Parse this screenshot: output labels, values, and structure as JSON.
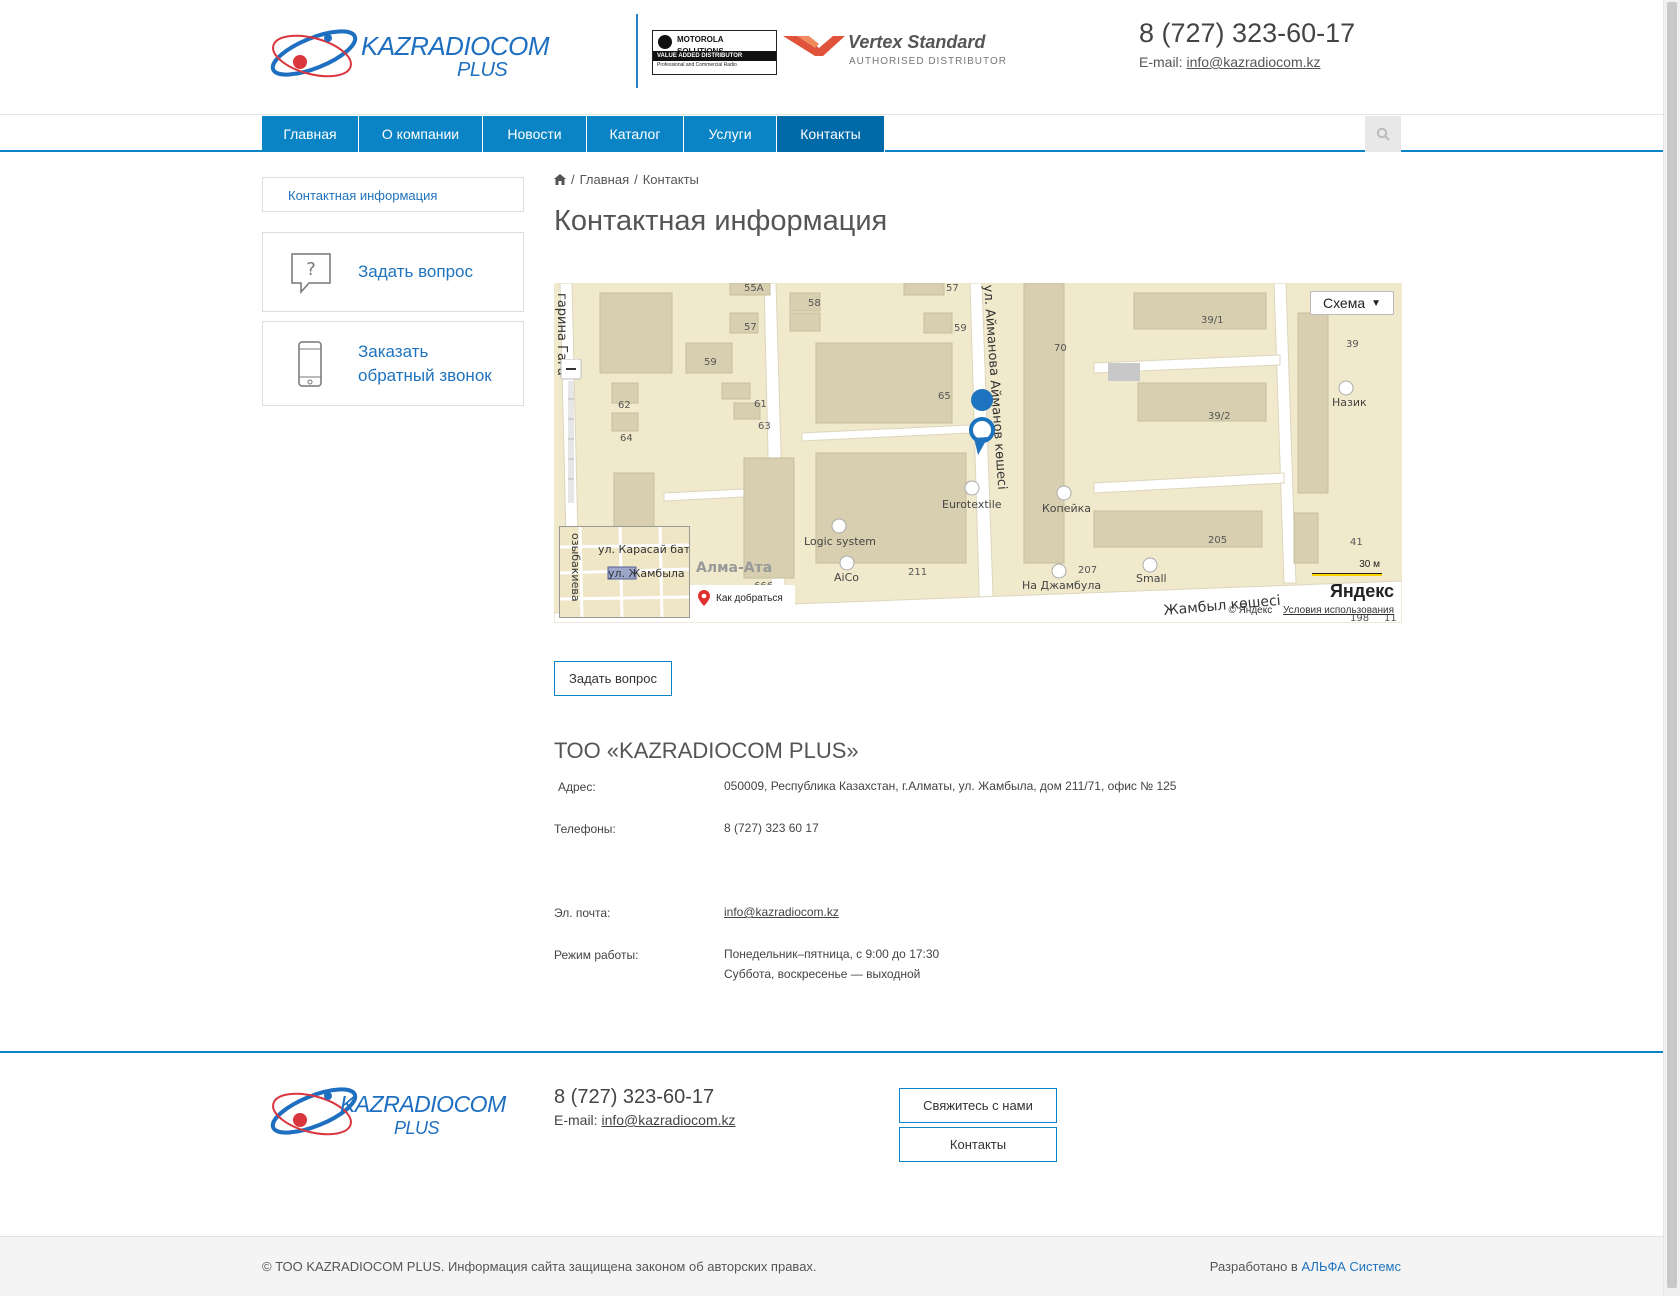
{
  "brand": {
    "logo_main": "KAZRADIOCOM",
    "logo_sub": "PLUS",
    "accent_color": "#0b84c6",
    "accent_dark": "#006aa8"
  },
  "partners": {
    "motorola_name": "MOTOROLA SOLUTIONS",
    "motorola_badge": "VALUE ADDED DISTRIBUTOR",
    "motorola_small": "Professional and Commercial Radio",
    "vertex_name": "Vertex Standard",
    "vertex_sub": "AUTHORISED DISTRIBUTOR"
  },
  "header": {
    "phone": "8 (727) 323-60-17",
    "email_label": "E-mail:",
    "email": "info@kazradiocom.kz"
  },
  "nav": {
    "items": [
      {
        "label": "Главная"
      },
      {
        "label": "О компании"
      },
      {
        "label": "Новости"
      },
      {
        "label": "Каталог"
      },
      {
        "label": "Услуги"
      },
      {
        "label": "Контакты",
        "active": true
      }
    ],
    "search_icon": "search-icon"
  },
  "sidebar": {
    "link": "Контактная информация",
    "ask": "Задать вопрос",
    "callback_line1": "Заказать",
    "callback_line2": "обратный звонок"
  },
  "breadcrumb": {
    "home_icon": "home-icon",
    "sep": "/",
    "items": [
      "Главная",
      "Контакты"
    ]
  },
  "page": {
    "title": "Контактная информация"
  },
  "map": {
    "scheme_label": "Схема",
    "route_label": "Как добраться",
    "scale_label": "30 м",
    "logo": "Яндекс",
    "copyright": "© Яндекс",
    "terms": "Условия использования",
    "labels": {
      "street_aimanov": "ул. Айманова Айманов көшесі",
      "street_zhambyl": "Жамбыл көшесі",
      "street_gagarin": "гарина Гага",
      "almaata": "Алма-Ата",
      "eurotextile": "Eurotextile",
      "kopeika": "Копейка",
      "nazik": "Назик",
      "logic_system": "Logic system",
      "aico": "AiCo",
      "na_zhambyla": "На Джамбула",
      "small": "Small",
      "mini_karasai": "ул. Карасай баты",
      "mini_zhambyla": "ул. Жамбыла",
      "mini_ozybak": "озыбакиева"
    },
    "houses": [
      "55А",
      "57",
      "58",
      "59",
      "57",
      "59",
      "62",
      "61",
      "63",
      "64",
      "65",
      "70",
      "39/1",
      "39",
      "39/2",
      "205",
      "41",
      "211",
      "207",
      "666",
      "198",
      "11"
    ]
  },
  "actions": {
    "ask_button": "Задать вопрос"
  },
  "company": {
    "name": "ТОО «KAZRADIOCOM PLUS»",
    "address_label": "Адрес:",
    "address": "050009, Республика Казахстан, г.Алматы, ул. Жамбыла, дом 211/71, офис № 125",
    "phones_label": "Телефоны:",
    "phones": "8 (727) 323 60 17",
    "email_label": "Эл. почта:",
    "email": "info@kazradiocom.kz",
    "hours_label": "Режим работы:",
    "hours_line1": "Понедельник–пятница, с 9:00 до 17:30",
    "hours_line2": "Суббота, воскресенье — выходной"
  },
  "footer": {
    "phone": "8 (727) 323-60-17",
    "email_label": "E-mail:",
    "email": "info@kazradiocom.kz",
    "contact_button": "Свяжитесь с нами",
    "contacts_button": "Контакты",
    "copyright": "© ТОО KAZRADIOCOM PLUS. Информация сайта защищена законом об авторских правах.",
    "dev_prefix": "Разработано в",
    "dev_name": "АЛЬФА Системс"
  }
}
